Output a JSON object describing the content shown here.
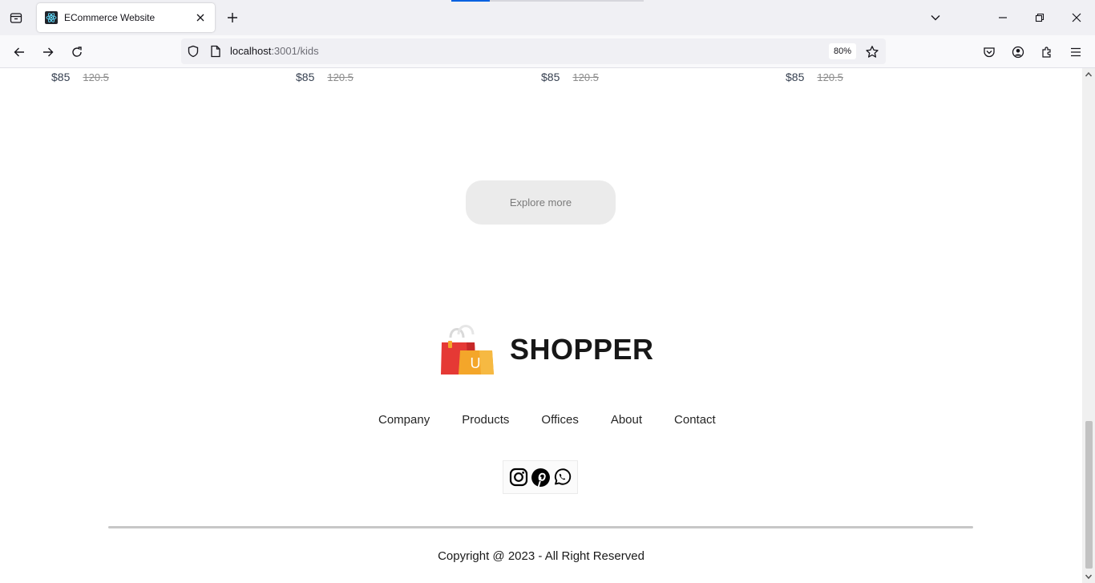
{
  "browser": {
    "tab": {
      "title": "ECommerce Website"
    },
    "url": {
      "host": "localhost",
      "path": ":3001/kids"
    },
    "zoom": "80%"
  },
  "products": [
    {
      "new_price": "$85",
      "old_price": "120.5"
    },
    {
      "new_price": "$85",
      "old_price": "120.5"
    },
    {
      "new_price": "$85",
      "old_price": "120.5"
    },
    {
      "new_price": "$85",
      "old_price": "120.5"
    }
  ],
  "explore": {
    "label": "Explore more"
  },
  "footer": {
    "logo_text": "SHOPPER",
    "links": [
      "Company",
      "Products",
      "Offices",
      "About",
      "Contact"
    ],
    "social_icons": [
      "instagram-icon",
      "pinterest-icon",
      "whatsapp-icon"
    ],
    "copyright": "Copyright @ 2023 - All Right Reserved"
  },
  "colors": {
    "accent": "#0061e0",
    "bag_red": "#e53935",
    "bag_orange": "#f4a62a"
  }
}
